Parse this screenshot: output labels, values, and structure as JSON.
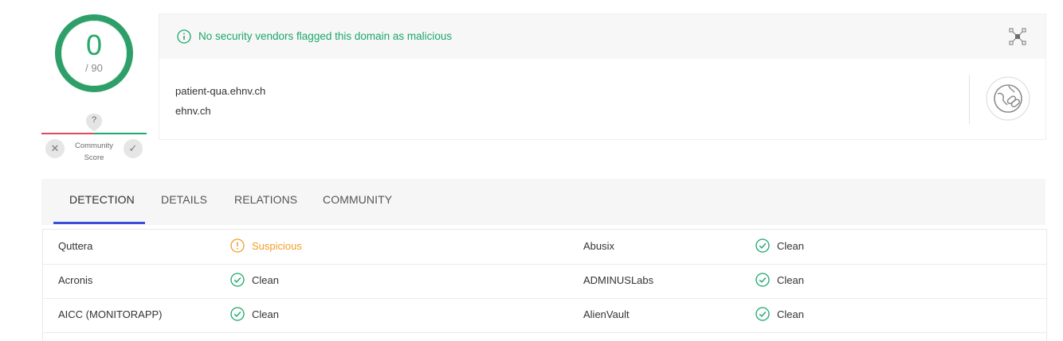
{
  "score": {
    "detections": "0",
    "total": "/ 90"
  },
  "community": {
    "unknown_glyph": "?",
    "label_line1": "Community",
    "label_line2": "Score",
    "down_glyph": "✕",
    "up_glyph": "✓"
  },
  "banner": {
    "message": "No security vendors flagged this domain as malicious",
    "color": "#1ba76a"
  },
  "domain": {
    "name": "patient-qua.ehnv.ch",
    "parent": "ehnv.ch"
  },
  "tabs": [
    {
      "label": "DETECTION",
      "active": true
    },
    {
      "label": "DETAILS"
    },
    {
      "label": "RELATIONS"
    },
    {
      "label": "COMMUNITY"
    }
  ],
  "detections": [
    {
      "left_vendor": "Quttera",
      "left_result": "Suspicious",
      "left_status": "suspicious",
      "right_vendor": "Abusix",
      "right_result": "Clean",
      "right_status": "clean"
    },
    {
      "left_vendor": "Acronis",
      "left_result": "Clean",
      "left_status": "clean",
      "right_vendor": "ADMINUSLabs",
      "right_result": "Clean",
      "right_status": "clean"
    },
    {
      "left_vendor": "AICC (MONITORAPP)",
      "left_result": "Clean",
      "left_status": "clean",
      "right_vendor": "AlienVault",
      "right_result": "Clean",
      "right_status": "clean"
    }
  ],
  "colors": {
    "clean": "#1ba76a",
    "suspicious": "#f29d27",
    "accent": "#3b4fd8",
    "malicious": "#e04a5f"
  }
}
